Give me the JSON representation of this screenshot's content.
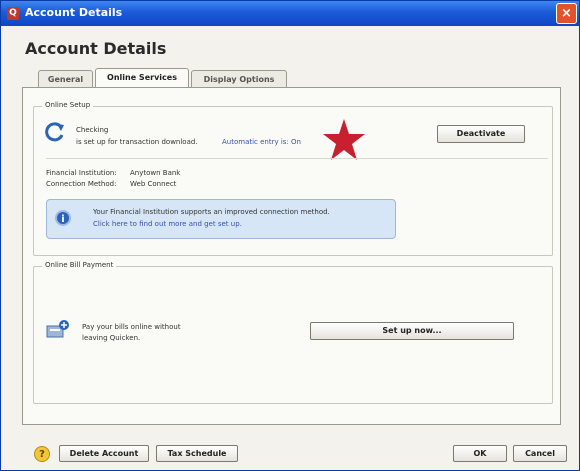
{
  "window": {
    "title": "Account Details",
    "close_glyph": "×"
  },
  "page": {
    "heading": "Account Details"
  },
  "tabs": [
    {
      "label": "General"
    },
    {
      "label": "Online Services"
    },
    {
      "label": "Display Options"
    }
  ],
  "online_setup": {
    "legend": "Online Setup",
    "account_name": "Checking",
    "status_text": "is set up for transaction download.",
    "auto_entry_label": "Automatic entry is: On",
    "deactivate_label": "Deactivate",
    "fi_label": "Financial Institution:",
    "fi_value": "Anytown Bank",
    "method_label": "Connection Method:",
    "method_value": "Web Connect",
    "info_line1": "Your Financial Institution supports an improved connection method.",
    "info_link": "Click here to find out more and get set up."
  },
  "bill_payment": {
    "legend": "Online Bill Payment",
    "text_line1": "Pay your bills online without",
    "text_line2": "leaving Quicken.",
    "setup_label": "Set up now..."
  },
  "footer": {
    "delete_label": "Delete Account",
    "tax_label": "Tax Schedule",
    "ok_label": "OK",
    "cancel_label": "Cancel"
  },
  "colors": {
    "star": "#c8202e",
    "title_bar": "#1c5ad8",
    "link": "#3552b0"
  },
  "icons": [
    "app-icon",
    "close-icon",
    "refresh-icon",
    "info-icon",
    "bill-pay-icon",
    "help-icon",
    "star-annotation"
  ]
}
